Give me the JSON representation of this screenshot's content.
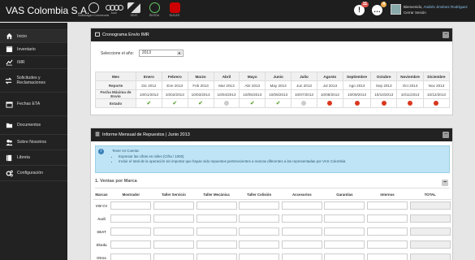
{
  "header": {
    "brand": "VAS Colombia S.A.",
    "brand_logos": [
      {
        "name": "volkswagen-logo",
        "caption": "Volkswagen Commercial"
      },
      {
        "name": "audi-logo",
        "caption": "Audi"
      },
      {
        "name": "seat-logo",
        "caption": "SEAT"
      },
      {
        "name": "skoda-logo",
        "caption": "ŠKODA"
      },
      {
        "name": "ducati-logo",
        "caption": "DUCATI"
      }
    ],
    "alerts_count": "11",
    "messages_count": "4",
    "welcome": "Bienvenido,",
    "user_name": "Andrés Jiménez Rodríguez",
    "logout": "Cerrar Sesión"
  },
  "sidebar": {
    "items": [
      {
        "label": "Inicio",
        "icon": "home-icon"
      },
      {
        "label": "Inventario",
        "icon": "box-icon"
      },
      {
        "label": "IMR",
        "icon": "chart-line-icon"
      },
      {
        "label": "Solicitudes y Reclamaciones",
        "icon": "exchange-icon"
      },
      {
        "label": "Fechas ETA",
        "icon": "calendar-icon"
      },
      {
        "label": "Documentos",
        "icon": "folder-icon"
      },
      {
        "label": "Sobre Nosotros",
        "icon": "users-icon"
      },
      {
        "label": "Libreta",
        "icon": "book-icon"
      },
      {
        "label": "Configuración",
        "icon": "cogs-icon"
      }
    ]
  },
  "cronograma": {
    "title": "Cronograma Envío IMR",
    "year_label": "Seleccione el año:",
    "year_value": "2013",
    "columns": [
      "Mes",
      "Enero",
      "Febrero",
      "Marzo",
      "Abril",
      "Mayo",
      "Junio",
      "Julio",
      "Agosto",
      "Septiembre",
      "Octubre",
      "Noviembre",
      "Diciembre"
    ],
    "rows": [
      {
        "label": "Reporte",
        "cells": [
          "Dic 2012",
          "Ene 2013",
          "Feb 2013",
          "Mar 2013",
          "Abr 2013",
          "May 2013",
          "Jun 2013",
          "Jul 2013",
          "Ago 2013",
          "Sep 2013",
          "Oct 2013",
          "Nov 2013"
        ]
      },
      {
        "label": "Fecha Máxima de Envío",
        "cells": [
          "10/01/2013",
          "10/02/2013",
          "10/03/2013",
          "10/04/2013",
          "10/05/2013",
          "10/06/2013",
          "10/07/2013",
          "10/08/2013",
          "10/09/2013",
          "10/10/2013",
          "10/11/2013",
          "10/12/2013"
        ]
      }
    ],
    "status_label": "Estado",
    "status": [
      "check",
      "check",
      "check",
      "pending",
      "check",
      "check",
      "pending",
      "late",
      "late",
      "late",
      "late",
      "late"
    ],
    "colors": {
      "check": "#4a9b1a",
      "pending": "#cccccc",
      "late": "#d9381e"
    }
  },
  "informe": {
    "title": "Informe Mensual de Repuestos | Junio 2013",
    "info_title": "Tener en Cuenta:",
    "info_items": [
      "Expresar las cifras en miles (Cifra / 1000)",
      "Incluir el total de la operación sin importar que hayan sido repuestos pertenecientes a marcas diferentes a las representadas por VAS Colombia"
    ],
    "section_title": "1. Ventas por Marca",
    "columns": [
      "Marcas",
      "Mostrador",
      "Taller Servicio",
      "Taller Mecánica",
      "Taller Colisión",
      "Accesorios",
      "Garantías",
      "Internos",
      "TOTAL"
    ],
    "brands": [
      "VW CV",
      "Audi",
      "SEAT",
      "Skoda",
      "Otros"
    ]
  }
}
